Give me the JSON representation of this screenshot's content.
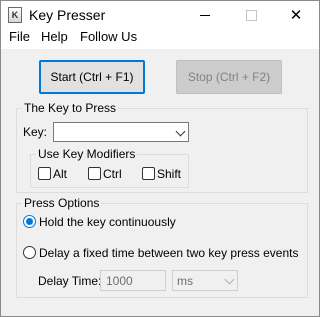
{
  "window": {
    "title": "Key Presser",
    "icon_letter": "K",
    "controls": {
      "minimize_icon": "minimize-icon",
      "maximize_icon": "maximize-icon",
      "close_icon": "close-icon",
      "close_glyph": "✕"
    }
  },
  "menu": {
    "items": [
      {
        "label": "File"
      },
      {
        "label": "Help"
      },
      {
        "label": "Follow Us"
      }
    ]
  },
  "buttons": {
    "start_label": "Start (Ctrl + F1)",
    "stop_label": "Stop (Ctrl + F2)",
    "stop_enabled": false
  },
  "key_group": {
    "title": "The Key to Press",
    "key_label": "Key:",
    "key_value": "",
    "modifiers": {
      "title": "Use Key Modifiers",
      "alt": {
        "label": "Alt",
        "checked": false
      },
      "ctrl": {
        "label": "Ctrl",
        "checked": false
      },
      "shift": {
        "label": "Shift",
        "checked": false
      }
    }
  },
  "press_options": {
    "title": "Press Options",
    "hold": {
      "label": "Hold the key continuously",
      "selected": true
    },
    "delay": {
      "label": "Delay a fixed time between two key press events",
      "selected": false
    },
    "delay_time_label": "Delay Time:",
    "delay_time_value": "1000",
    "unit_value": "ms"
  },
  "colors": {
    "accent": "#0078d7",
    "window_bg": "#f0f0f0",
    "disabled_text": "#838383"
  }
}
